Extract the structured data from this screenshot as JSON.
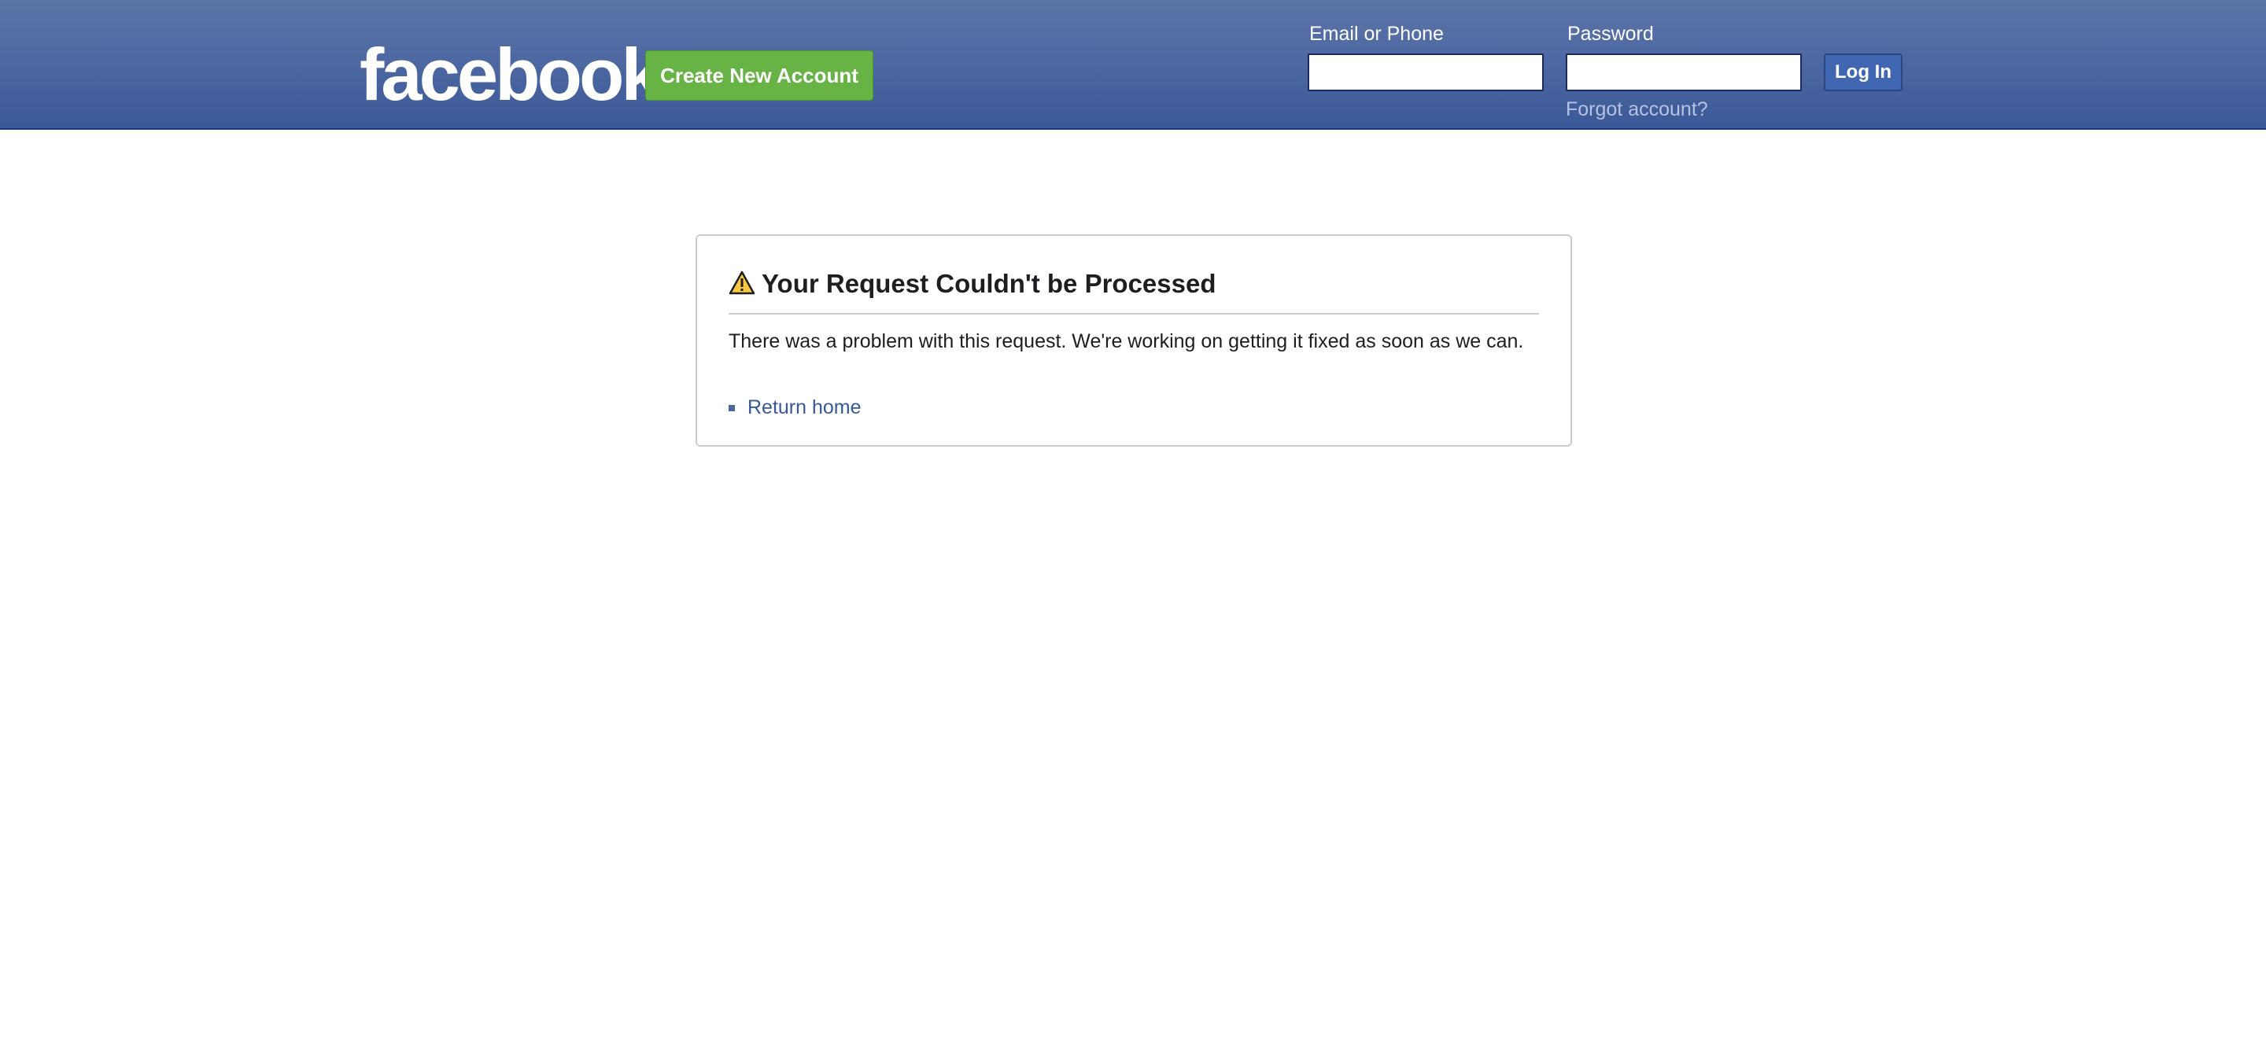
{
  "header": {
    "logo_text": "facebook",
    "create_account_label": "Create New Account",
    "email_label": "Email or Phone",
    "email_value": "",
    "password_label": "Password",
    "password_value": "",
    "login_label": "Log In",
    "forgot_label": "Forgot account?"
  },
  "error": {
    "title": "Your Request Couldn't be Processed",
    "message": "There was a problem with this request. We're working on getting it fixed as soon as we can.",
    "links": [
      {
        "label": "Return home"
      }
    ]
  },
  "colors": {
    "brand_blue": "#3b5998",
    "create_green": "#67b346",
    "warning_yellow": "#f7c744",
    "link_blue": "#385898"
  },
  "icons": {
    "warning": "warning-triangle-icon"
  }
}
